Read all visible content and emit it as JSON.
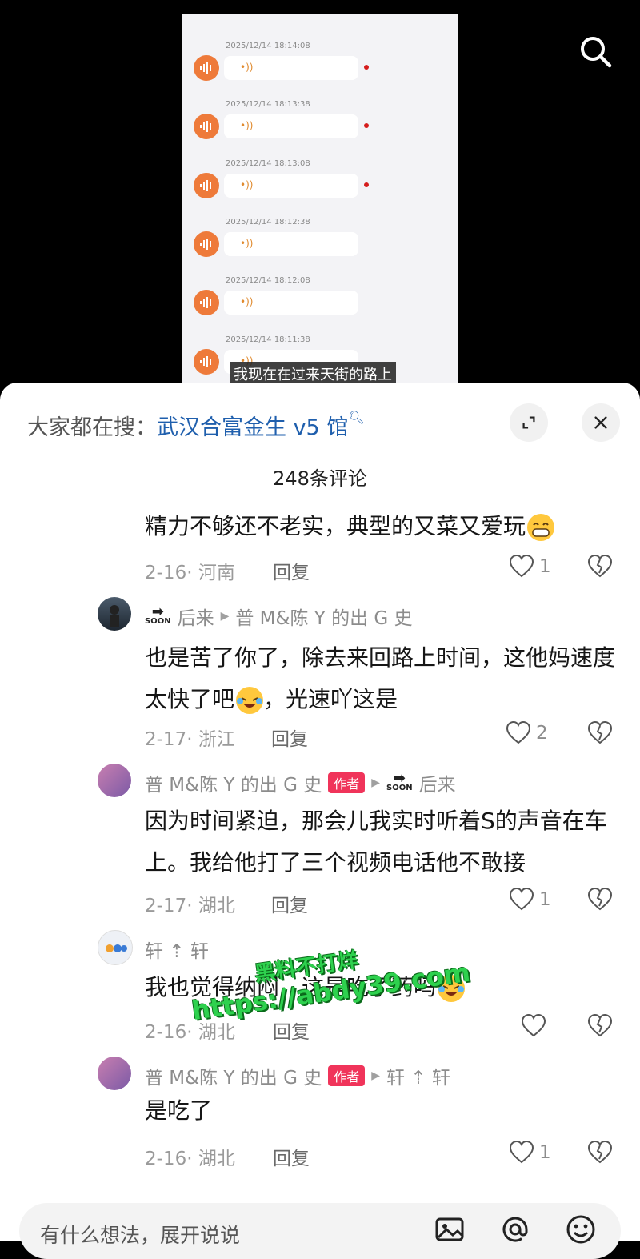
{
  "video": {
    "voice_messages": [
      {
        "time": "2025/12/14 18:14:08",
        "unread": true
      },
      {
        "time": "2025/12/14 18:13:38",
        "unread": true
      },
      {
        "time": "2025/12/14 18:13:08",
        "unread": true
      },
      {
        "time": "2025/12/14 18:12:38",
        "unread": false
      },
      {
        "time": "2025/12/14 18:12:08",
        "unread": false
      },
      {
        "time": "2025/12/14 18:11:38",
        "unread": false
      }
    ],
    "subtitle": "我现在在过来天街的路上",
    "search_icon": "search-icon"
  },
  "sheet": {
    "hot_search_prefix": "大家都在搜：",
    "hot_search_keyword": "武汉合富金生 v5 馆",
    "comment_count": "248条评论"
  },
  "comments": [
    {
      "text": "精力不够还不老实，典型的又菜又爱玩",
      "date": "2-16",
      "location": "河南",
      "reply": "回复",
      "likes": "1"
    },
    {
      "author": "后来",
      "reply_to": "普 M&陈 Y 的出 G 史",
      "text": "也是苦了你了，除去来回路上时间，这他妈速度太快了吧",
      "text2": "，光速吖这是",
      "date": "2-17",
      "location": "浙江",
      "reply": "回复",
      "likes": "2"
    },
    {
      "author": "普 M&陈 Y 的出 G 史",
      "badge": "作者",
      "reply_to": "后来",
      "text": "因为时间紧迫，那会儿我实时听着S的声音在车上。我给他打了三个视频电话他不敢接",
      "date": "2-17",
      "location": "湖北",
      "reply": "回复",
      "likes": "1"
    },
    {
      "author": "轩 ⇡ 轩",
      "text": "我也觉得纳闷，这是吃了药吗",
      "date": "2-16",
      "location": "湖北",
      "reply": "回复",
      "likes": ""
    },
    {
      "author": "普 M&陈 Y 的出 G 史",
      "badge": "作者",
      "reply_to": "轩 ⇡ 轩",
      "text": "是吃了",
      "date": "2-16",
      "location": "湖北",
      "reply": "回复",
      "likes": "1"
    }
  ],
  "watermark": {
    "line1": "黑料不打烊",
    "line2": "https://abdy39.com"
  },
  "bottom_bar": {
    "placeholder": "有什么想法，展开说说",
    "icons": [
      "image-icon",
      "mention-icon",
      "emoji-icon"
    ]
  },
  "colors": {
    "accent_link": "#1f5fad",
    "author_badge": "#f0345a",
    "voice_avatar": "#ee7a3a",
    "unread_dot": "#d51c1c"
  }
}
